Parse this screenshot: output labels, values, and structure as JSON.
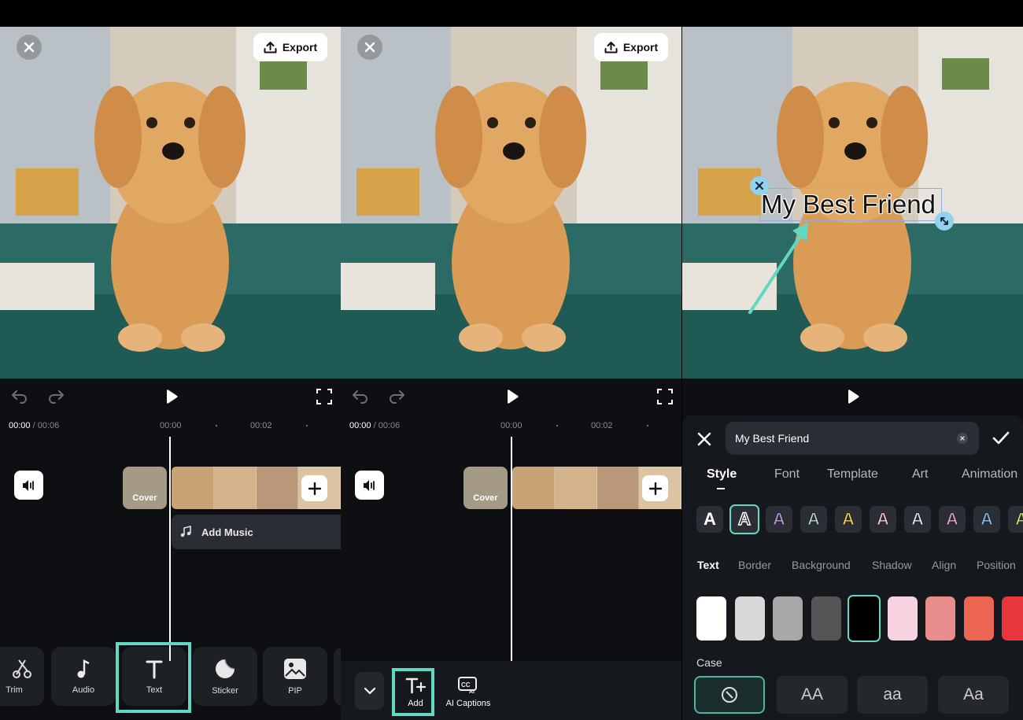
{
  "panel1": {
    "export_label": "Export",
    "time_current": "00:00",
    "time_total": "/ 00:06",
    "ticks": [
      "00:00",
      "00:02"
    ],
    "cover_label": "Cover",
    "add_music_label": "Add Music",
    "tools": [
      {
        "label": "Trim",
        "icon": "scissors-icon"
      },
      {
        "label": "Audio",
        "icon": "music-note-icon"
      },
      {
        "label": "Text",
        "icon": "text-icon"
      },
      {
        "label": "Sticker",
        "icon": "sticker-icon"
      },
      {
        "label": "PIP",
        "icon": "image-icon"
      }
    ]
  },
  "panel2": {
    "export_label": "Export",
    "time_current": "00:00",
    "time_total": "/ 00:06",
    "ticks": [
      "00:00",
      "00:02"
    ],
    "cover_label": "Cover",
    "tools": [
      {
        "label": "Add",
        "icon": "add-text-icon"
      },
      {
        "label": "AI Captions",
        "icon": "ai-captions-icon"
      }
    ]
  },
  "panel3": {
    "overlay_text": "My Best Friend",
    "text_input_value": "My Best Friend",
    "tabs": [
      "Style",
      "Font",
      "Template",
      "Art",
      "Animation"
    ],
    "active_tab": "Style",
    "subtabs": [
      "Text",
      "Border",
      "Background",
      "Shadow",
      "Align",
      "Position"
    ],
    "active_subtab": "Text",
    "case_label": "Case",
    "case_options": [
      "AA",
      "aa",
      "Aa"
    ],
    "style_letter": "A",
    "style_swatches": [
      "#ffffff",
      "#ffffff",
      "#b59ae6",
      "#b7dbc6",
      "#f3d64a",
      "#f6c8d2",
      "#dfe6f5",
      "#f0a0c8",
      "#7fc0f0",
      "#c8e080"
    ],
    "colors": [
      "#ffffff",
      "#d8d8d8",
      "#a8a8a8",
      "#555555",
      "#000000",
      "#f7d3e2",
      "#e88c8c",
      "#ec6452",
      "#e8373c"
    ],
    "selected_color": "#000000",
    "accent_color": "#5fd9c2"
  }
}
